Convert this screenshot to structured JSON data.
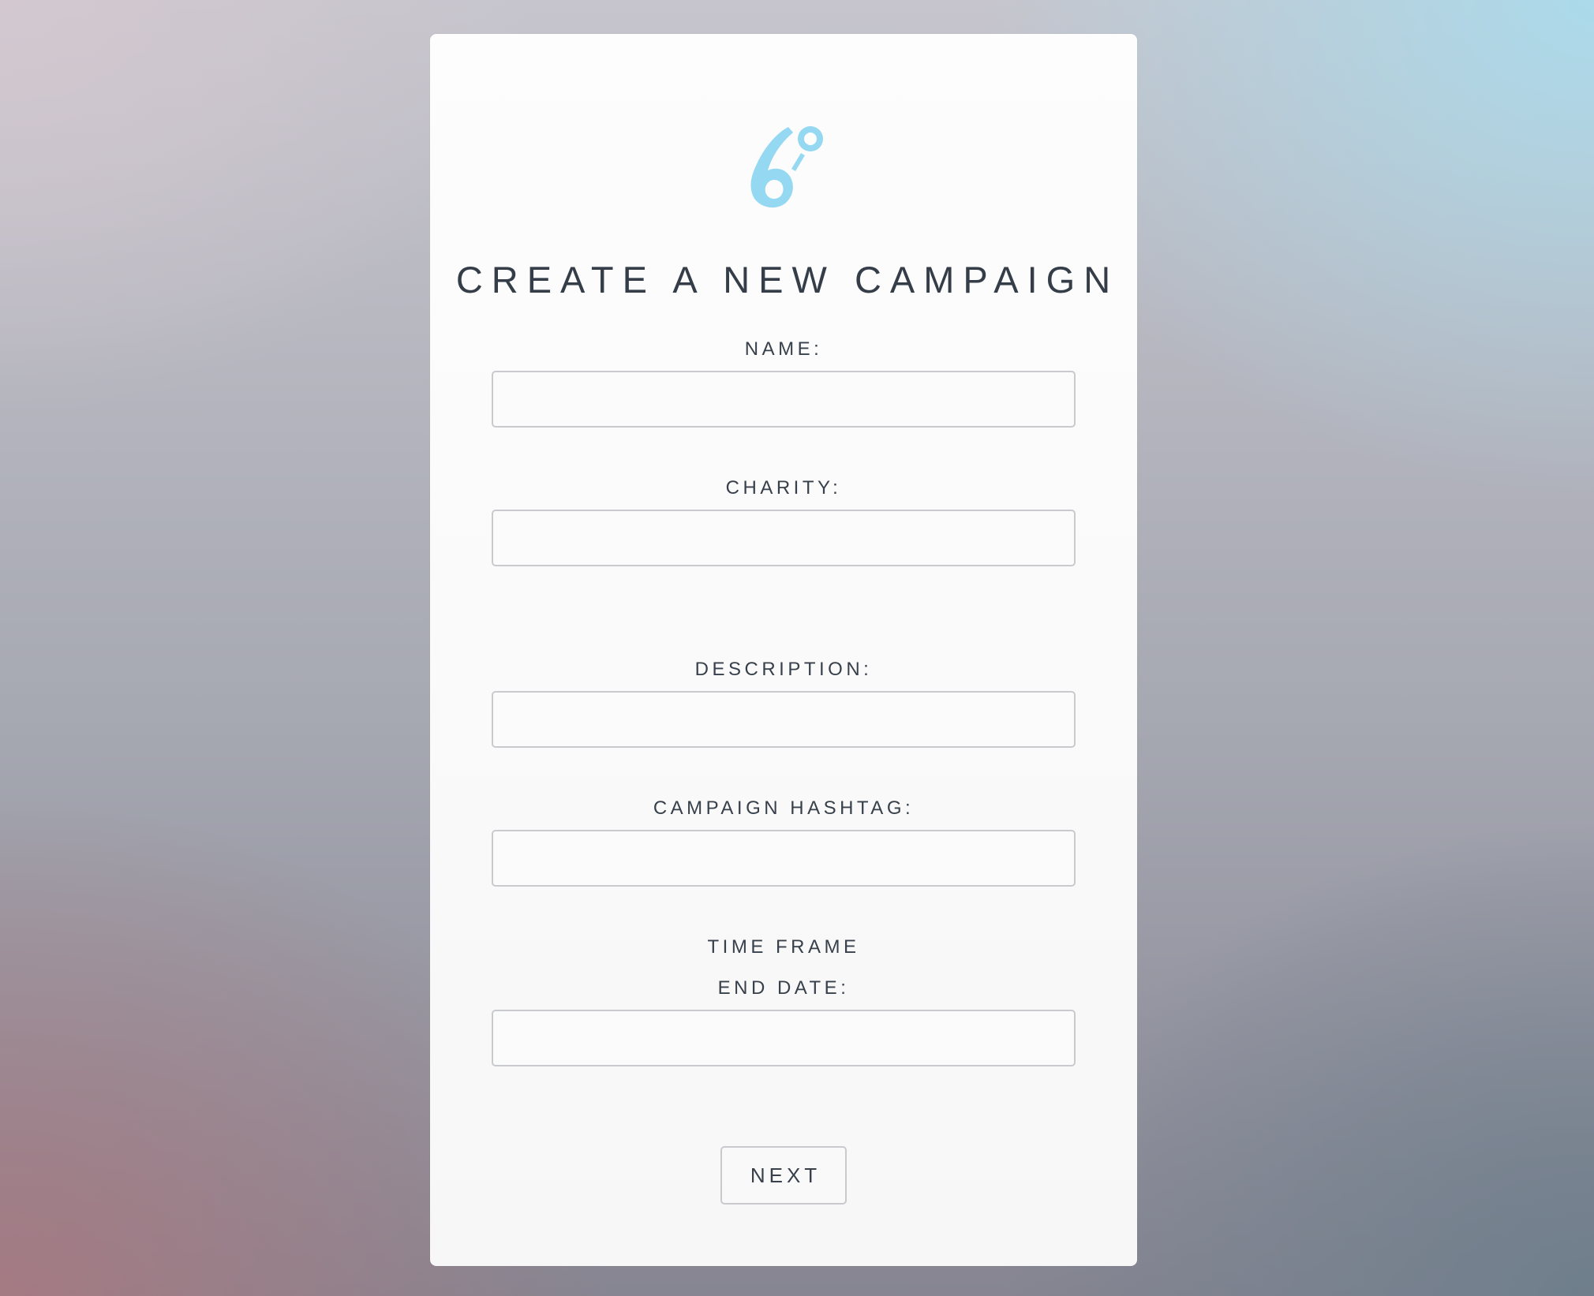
{
  "page": {
    "title": "CREATE A NEW CAMPAIGN",
    "logo": {
      "icon": "six-degrees-logo-icon",
      "color": "#94d8f2"
    }
  },
  "form": {
    "name_label": "NAME:",
    "name_value": "",
    "charity_label": "CHARITY:",
    "charity_value": "",
    "description_label": "DESCRIPTION:",
    "description_value": "",
    "hashtag_label": "CAMPAIGN HASHTAG:",
    "hashtag_value": "",
    "time_frame_label": "TIME FRAME",
    "end_date_label": "END DATE:",
    "end_date_value": ""
  },
  "actions": {
    "next_label": "NEXT"
  },
  "colors": {
    "text": "#37404b",
    "input_border": "#c9cacd",
    "accent": "#94d8f2"
  }
}
